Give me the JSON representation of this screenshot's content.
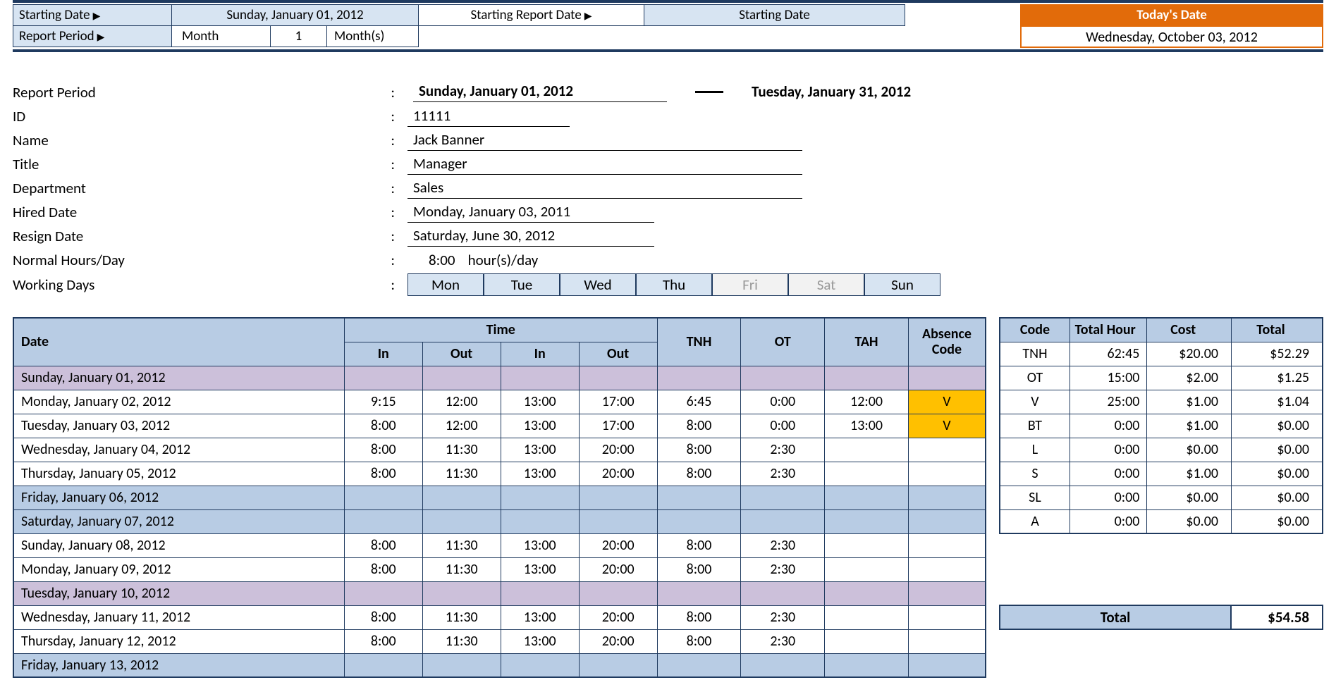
{
  "topbar": {
    "starting_date_label": "Starting Date",
    "starting_date_value": "Sunday, January 01, 2012",
    "report_period_label": "Report Period",
    "report_period_unit": "Month",
    "report_period_num": "1",
    "report_period_suffix": "Month(s)",
    "starting_report_date_label": "Starting Report Date",
    "starting_report_date_value": "Starting Date",
    "today_label": "Today's Date",
    "today_value": "Wednesday, October 03, 2012"
  },
  "info": {
    "report_period_label": "Report Period",
    "report_period_start": "Sunday, January 01, 2012",
    "report_period_end": "Tuesday, January 31, 2012",
    "id_label": "ID",
    "id": "11111",
    "name_label": "Name",
    "name": "Jack Banner",
    "title_label": "Title",
    "title": "Manager",
    "dept_label": "Department",
    "dept": "Sales",
    "hired_label": "Hired Date",
    "hired": "Monday, January 03, 2011",
    "resign_label": "Resign Date",
    "resign": "Saturday, June 30, 2012",
    "nh_label": "Normal Hours/Day",
    "nh_hours": "8:00",
    "nh_suffix": "hour(s)/day",
    "wd_label": "Working Days",
    "wd": [
      {
        "d": "Mon",
        "on": true
      },
      {
        "d": "Tue",
        "on": true
      },
      {
        "d": "Wed",
        "on": true
      },
      {
        "d": "Thu",
        "on": true
      },
      {
        "d": "Fri",
        "on": false
      },
      {
        "d": "Sat",
        "on": false
      },
      {
        "d": "Sun",
        "on": true
      }
    ]
  },
  "tt_headers": {
    "date": "Date",
    "time": "Time",
    "in": "In",
    "out": "Out",
    "tnh": "TNH",
    "ot": "OT",
    "tah": "TAH",
    "abs": "Absence Code"
  },
  "timesheet": [
    {
      "date": "Sunday, January 01, 2012",
      "type": "holiday"
    },
    {
      "date": "Monday, January 02, 2012",
      "in1": "9:15",
      "out1": "12:00",
      "in2": "13:00",
      "out2": "17:00",
      "tnh": "6:45",
      "ot": "0:00",
      "tah": "12:00",
      "abs": "V"
    },
    {
      "date": "Tuesday, January 03, 2012",
      "in1": "8:00",
      "out1": "12:00",
      "in2": "13:00",
      "out2": "17:00",
      "tnh": "8:00",
      "ot": "0:00",
      "tah": "13:00",
      "abs": "V"
    },
    {
      "date": "Wednesday, January 04, 2012",
      "in1": "8:00",
      "out1": "11:30",
      "in2": "13:00",
      "out2": "20:00",
      "tnh": "8:00",
      "ot": "2:30"
    },
    {
      "date": "Thursday, January 05, 2012",
      "in1": "8:00",
      "out1": "11:30",
      "in2": "13:00",
      "out2": "20:00",
      "tnh": "8:00",
      "ot": "2:30"
    },
    {
      "date": "Friday, January 06, 2012",
      "type": "weekend"
    },
    {
      "date": "Saturday, January 07, 2012",
      "type": "weekend"
    },
    {
      "date": "Sunday, January 08, 2012",
      "in1": "8:00",
      "out1": "11:30",
      "in2": "13:00",
      "out2": "20:00",
      "tnh": "8:00",
      "ot": "2:30"
    },
    {
      "date": "Monday, January 09, 2012",
      "in1": "8:00",
      "out1": "11:30",
      "in2": "13:00",
      "out2": "20:00",
      "tnh": "8:00",
      "ot": "2:30"
    },
    {
      "date": "Tuesday, January 10, 2012",
      "type": "holiday"
    },
    {
      "date": "Wednesday, January 11, 2012",
      "in1": "8:00",
      "out1": "11:30",
      "in2": "13:00",
      "out2": "20:00",
      "tnh": "8:00",
      "ot": "2:30"
    },
    {
      "date": "Thursday, January 12, 2012",
      "in1": "8:00",
      "out1": "11:30",
      "in2": "13:00",
      "out2": "20:00",
      "tnh": "8:00",
      "ot": "2:30"
    },
    {
      "date": "Friday, January 13, 2012",
      "type": "weekend"
    }
  ],
  "summ_headers": {
    "code": "Code",
    "th": "Total Hour",
    "cost": "Cost",
    "total": "Total"
  },
  "summary": [
    {
      "code": "TNH",
      "th": "62:45",
      "cost": "$20.00",
      "total": "$52.29"
    },
    {
      "code": "OT",
      "th": "15:00",
      "cost": "$2.00",
      "total": "$1.25"
    },
    {
      "code": "V",
      "th": "25:00",
      "cost": "$1.00",
      "total": "$1.04"
    },
    {
      "code": "BT",
      "th": "0:00",
      "cost": "$1.00",
      "total": "$0.00"
    },
    {
      "code": "L",
      "th": "0:00",
      "cost": "$0.00",
      "total": "$0.00"
    },
    {
      "code": "S",
      "th": "0:00",
      "cost": "$1.00",
      "total": "$0.00"
    },
    {
      "code": "SL",
      "th": "0:00",
      "cost": "$0.00",
      "total": "$0.00"
    },
    {
      "code": "A",
      "th": "0:00",
      "cost": "$0.00",
      "total": "$0.00"
    }
  ],
  "grand_total_label": "Total",
  "grand_total": "$54.58",
  "colon": ":"
}
